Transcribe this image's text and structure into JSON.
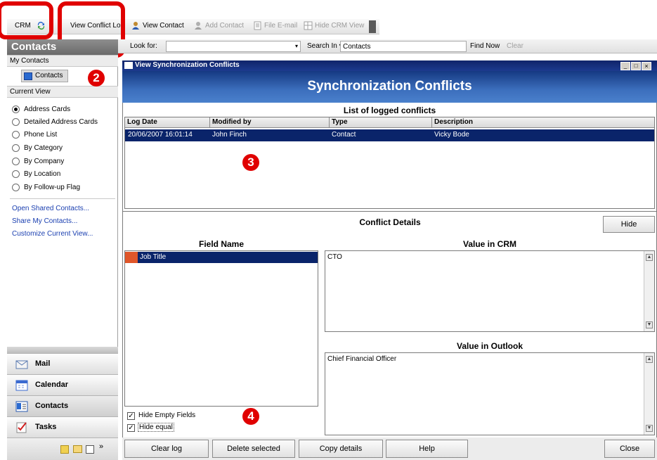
{
  "toolbar": {
    "crm": "CRM",
    "view_conflict_log": "View Conflict Lo",
    "view_contact": "View Contact",
    "add_contact": "Add Contact",
    "file_email": "File E-mail",
    "hide_crm_view": "Hide CRM View"
  },
  "sidebar": {
    "title": "Contacts",
    "my_contacts_header": "My Contacts",
    "contacts_item": "Contacts",
    "current_view_header": "Current View",
    "views": [
      {
        "label": "Address Cards",
        "selected": true
      },
      {
        "label": "Detailed Address Cards",
        "selected": false
      },
      {
        "label": "Phone List",
        "selected": false
      },
      {
        "label": "By Category",
        "selected": false
      },
      {
        "label": "By Company",
        "selected": false
      },
      {
        "label": "By Location",
        "selected": false
      },
      {
        "label": "By Follow-up Flag",
        "selected": false
      }
    ],
    "links": [
      "Open Shared Contacts...",
      "Share My Contacts...",
      "Customize Current View..."
    ],
    "nav": [
      {
        "label": "Mail",
        "icon": "mail-icon"
      },
      {
        "label": "Calendar",
        "icon": "calendar-icon"
      },
      {
        "label": "Contacts",
        "icon": "contacts-icon"
      },
      {
        "label": "Tasks",
        "icon": "tasks-icon"
      }
    ]
  },
  "search": {
    "look_for_label": "Look for:",
    "search_in_label": "Search In",
    "search_in_value": "Contacts",
    "find_now": "Find Now",
    "clear": "Clear"
  },
  "dialog": {
    "title": "View Synchronization Conflicts",
    "banner": "Synchronization Conflicts",
    "list_title": "List of logged conflicts",
    "columns": [
      "Log Date",
      "Modified by",
      "Type",
      "Description"
    ],
    "rows": [
      [
        "20/06/2007 16:01:14",
        "John Finch",
        "Contact",
        "Vicky Bode"
      ]
    ],
    "details_title": "Conflict Details",
    "hide_button": "Hide",
    "field_name_header": "Field Name",
    "fields": [
      "Job Title"
    ],
    "value_crm_header": "Value in CRM",
    "value_crm": "CTO",
    "value_outlook_header": "Value in Outlook",
    "value_outlook": "Chief Financial Officer",
    "hide_empty_fields": "Hide Empty Fields",
    "hide_equal": "Hide equal",
    "buttons": {
      "clear_log": "Clear log",
      "delete_selected": "Delete selected",
      "copy_details": "Copy details",
      "help": "Help",
      "close": "Close"
    }
  },
  "annotations": [
    "2",
    "3",
    "4"
  ],
  "colors": {
    "highlight": "#0a246a",
    "annotation": "#e00000",
    "banner": "#2d5aa8"
  }
}
